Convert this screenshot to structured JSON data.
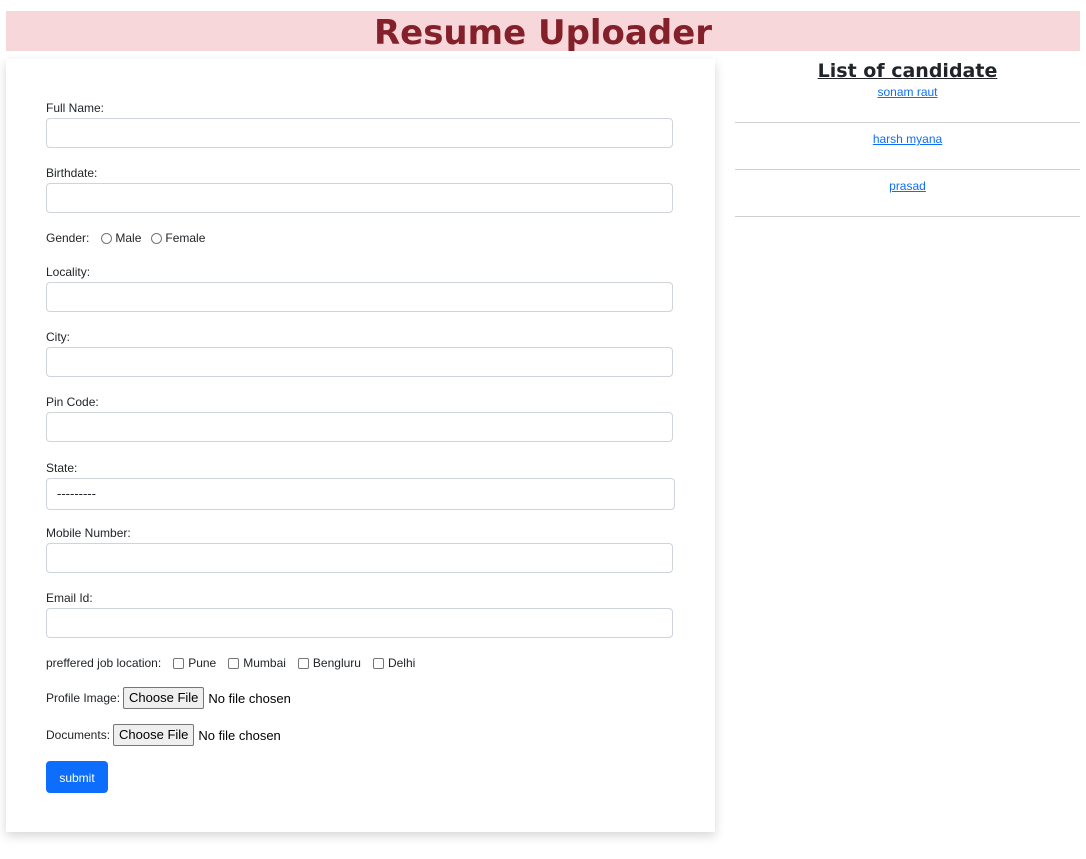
{
  "header": {
    "title": "Resume Uploader",
    "bg_color": "#f8d7da",
    "text_color": "#842029"
  },
  "form": {
    "full_name_label": "Full Name:",
    "birthdate_label": "Birthdate:",
    "gender_label": "Gender:",
    "gender_options": [
      "Male",
      "Female"
    ],
    "locality_label": "Locality:",
    "city_label": "City:",
    "pin_label": "Pin Code:",
    "state_label": "State:",
    "state_value": "---------",
    "mobile_label": "Mobile Number:",
    "email_label": "Email Id:",
    "job_location_label": "preffered job location:",
    "job_locations": [
      "Pune",
      "Mumbai",
      "Bengluru",
      "Delhi"
    ],
    "profile_image_label": "Profile Image:",
    "documents_label": "Documents:",
    "choose_file_label": "Choose File",
    "no_file_text": "No file chosen",
    "submit_label": "submit",
    "submit_color": "#0d6efd"
  },
  "sidebar": {
    "title": "List of candidate",
    "candidates": [
      "sonam raut",
      "harsh myana",
      "prasad"
    ]
  }
}
